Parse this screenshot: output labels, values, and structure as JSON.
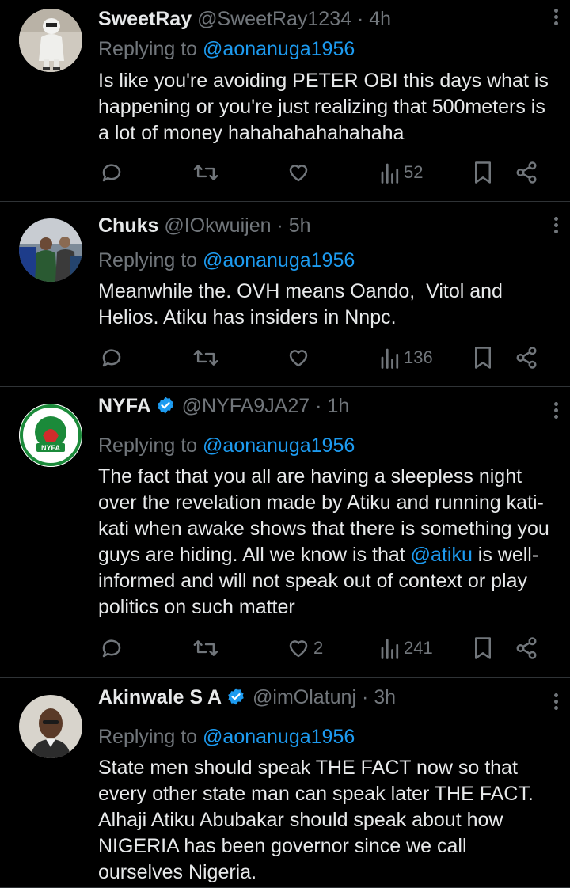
{
  "tweets": [
    {
      "name": "SweetRay",
      "handle": "@SweetRay1234",
      "dot": "·",
      "time": "4h",
      "verified": false,
      "replying_prefix": "Replying to ",
      "replying_to": "@aonanuga1956",
      "text": "Is like you're avoiding PETER OBI this days what is happening or you're just realizing that 500meters is a lot of money hahahahahahahaha",
      "likes": "",
      "views": "52",
      "avatar": "person-figure-icon"
    },
    {
      "name": "Chuks",
      "handle": "@IOkwuijen",
      "dot": "·",
      "time": "5h",
      "verified": false,
      "replying_prefix": "Replying to ",
      "replying_to": "@aonanuga1956",
      "text": "Meanwhile the. OVH means Oando,  Vitol and Helios. Atiku has insiders in Nnpc.",
      "likes": "",
      "views": "136",
      "avatar": "crowd-photo-icon"
    },
    {
      "name": "NYFA",
      "handle": "@NYFA9JA27",
      "dot": "·",
      "time": "1h",
      "verified": true,
      "replying_prefix": "Replying to ",
      "replying_to": "@aonanuga1956",
      "text_before": "The fact that you all are having a sleepless night over the revelation made by Atiku and running kati-kati when awake shows that there is something you guys are hiding. All we know is that ",
      "mention": "@atiku",
      "text_after": " is well-informed and will not speak out of context or play politics on such matter",
      "likes": "2",
      "views": "241",
      "avatar": "nyfa-logo-icon",
      "logo_text": "NYFA"
    },
    {
      "name": "Akinwale S A",
      "handle": "@imOlatunj",
      "dot": "·",
      "time": "3h",
      "verified": true,
      "replying_prefix": "Replying to ",
      "replying_to": "@aonanuga1956",
      "text": "State men should speak THE FACT now so that every other state man can speak later THE FACT. Alhaji Atiku Abubakar should speak about how NIGERIA has been governor since we call ourselves Nigeria.",
      "avatar": "man-portrait-icon"
    }
  ],
  "colors": {
    "background": "#000000",
    "text": "#e7e9ea",
    "muted": "#71767b",
    "accent": "#1d9bf0",
    "divider": "#2f3336"
  }
}
